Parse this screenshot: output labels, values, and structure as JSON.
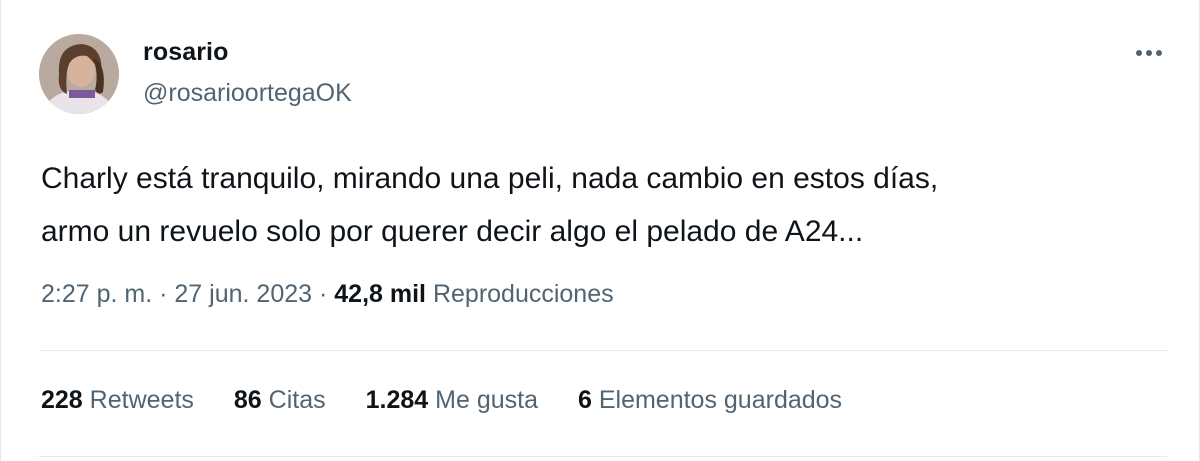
{
  "author": {
    "name": "rosario",
    "handle": "@rosarioortegaOK"
  },
  "tweet": {
    "line1": "Charly está tranquilo, mirando una peli, nada cambio en estos días,",
    "line2": "armo un revuelo solo por querer decir algo el pelado de A24..."
  },
  "meta": {
    "time": "2:27 p. m.",
    "separator": "·",
    "date": "27 jun. 2023",
    "views_count": "42,8 mil",
    "views_label": "Reproducciones"
  },
  "stats": [
    {
      "count": "228",
      "label": "Retweets"
    },
    {
      "count": "86",
      "label": "Citas"
    },
    {
      "count": "1.284",
      "label": "Me gusta"
    },
    {
      "count": "6",
      "label": "Elementos guardados"
    }
  ],
  "colors": {
    "text": "#0f1419",
    "secondary": "#536471",
    "border": "#e7e9ea"
  },
  "icons": {
    "more": "more-options-icon"
  }
}
